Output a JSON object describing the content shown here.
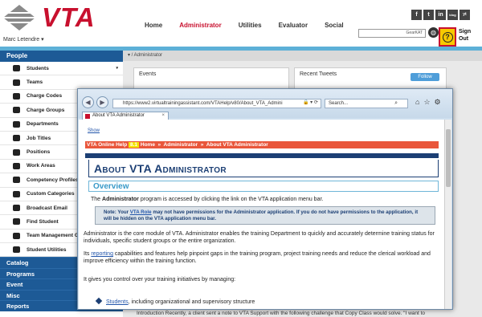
{
  "brand": {
    "logo_text": "VTA",
    "user_name": "Marc Letendre"
  },
  "topnav": [
    {
      "label": "Home",
      "active": false
    },
    {
      "label": "Administrator",
      "active": true
    },
    {
      "label": "Utilities",
      "active": false
    },
    {
      "label": "Evaluator",
      "active": false
    },
    {
      "label": "Social",
      "active": false
    }
  ],
  "social": [
    "f",
    "t",
    "in",
    "blog",
    "yt"
  ],
  "header_search": {
    "value": "GearKAT"
  },
  "signout": {
    "line1": "Sign",
    "line2": "Out"
  },
  "sidebar": {
    "heading": "People",
    "items": [
      {
        "label": "Students",
        "icon": "person-icon",
        "has_caret": true
      },
      {
        "label": "Teams",
        "icon": "team-icon",
        "has_caret": false
      },
      {
        "label": "Charge Codes",
        "icon": "card-icon",
        "has_caret": false
      },
      {
        "label": "Charge Groups",
        "icon": "card-group-icon",
        "has_caret": false
      },
      {
        "label": "Departments",
        "icon": "building-icon",
        "has_caret": false
      },
      {
        "label": "Job Titles",
        "icon": "briefcase-icon",
        "has_caret": false
      },
      {
        "label": "Positions",
        "icon": "person-icon",
        "has_caret": false
      },
      {
        "label": "Work Areas",
        "icon": "gear-icon",
        "has_caret": false
      },
      {
        "label": "Competency Profiles",
        "icon": "gear-icon",
        "has_caret": false
      },
      {
        "label": "Custom Categories",
        "icon": "folder-icon",
        "has_caret": false
      },
      {
        "label": "Broadcast Email",
        "icon": "mail-icon",
        "has_caret": false
      },
      {
        "label": "Find Student",
        "icon": "person-icon",
        "has_caret": false
      },
      {
        "label": "Team Management G",
        "icon": "team-icon",
        "has_caret": false
      },
      {
        "label": "Student Utilities",
        "icon": "gear-icon",
        "has_caret": false
      }
    ],
    "categories": [
      "Catalog",
      "Programs",
      "Event",
      "Misc",
      "Reports"
    ]
  },
  "breadcrumb": "▾ / Administrator",
  "panels": {
    "events": "Events",
    "tweets": "Recent Tweets",
    "follow": "Follow"
  },
  "bottom_text": "Introduction Recently, a client sent a note to VTA Support with the following challenge that Copy Class would solve. \"I want to",
  "browser": {
    "url": "https://www2.virtualtrainingassistant.com/VTAHelp/v80/About_VTA_Admini",
    "search_placeholder": "Search...",
    "tab_label": "About VTA Administrator",
    "show_link": "Show",
    "breadcrumb_parts": [
      "VTA Online Help ",
      "8.1",
      " Home",
      "  »  ",
      "Administrator",
      "  »  ",
      "About VTA Administrator"
    ],
    "page_title": "About VTA Administrator",
    "section": "Overview",
    "intro_pre": "The ",
    "intro_bold": "Administrator",
    "intro_post": " program is accessed by clicking the link on the VTA application menu bar.",
    "note_pre": "Note: Your ",
    "note_link": "VTA Role",
    "note_post": " may not have permissions for the Administrator application.  If you do not have permissions to the application, it will be hidden on the VTA application menu bar.",
    "para1": "Administrator is the core module of VTA. Administrator enables the training Department to quickly and accurately determine training status for individuals, specific student groups or the entire organization.",
    "para2_pre": "Its ",
    "para2_link": "reporting",
    "para2_post": " capabilities and features help pinpoint gaps in the training program, project training needs and reduce the clerical workload and improve efficiency within the training function.",
    "para3": "It gives you control over your training initiatives by managing:",
    "bullet_link": "Students",
    "bullet_post": ", including organizational and supervisory structure"
  },
  "colors": {
    "brand_red": "#c8102e",
    "nav_blue": "#1d5a96",
    "accent_blue": "#5db0d7",
    "help_yellow": "#f7c900"
  }
}
